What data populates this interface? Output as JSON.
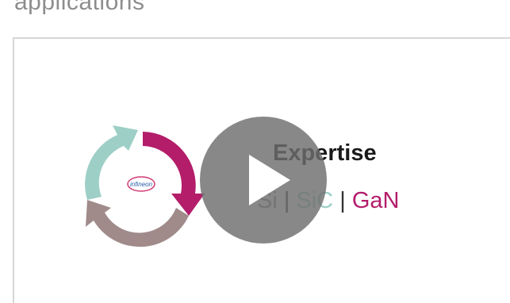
{
  "page": {
    "heading": "applications"
  },
  "video": {
    "title": "Expertise",
    "materials": {
      "si": "Si",
      "sic": "SiC",
      "gan": "GaN",
      "separator": "|"
    },
    "logo_text": "infineon"
  },
  "colors": {
    "magenta": "#b31d6a",
    "teal": "#9ecfc7",
    "mauve": "#a08a8a",
    "play_overlay": "#6e6e6e"
  },
  "icons": {
    "play": "play-icon",
    "cycle": "cycle-arrows-icon"
  }
}
